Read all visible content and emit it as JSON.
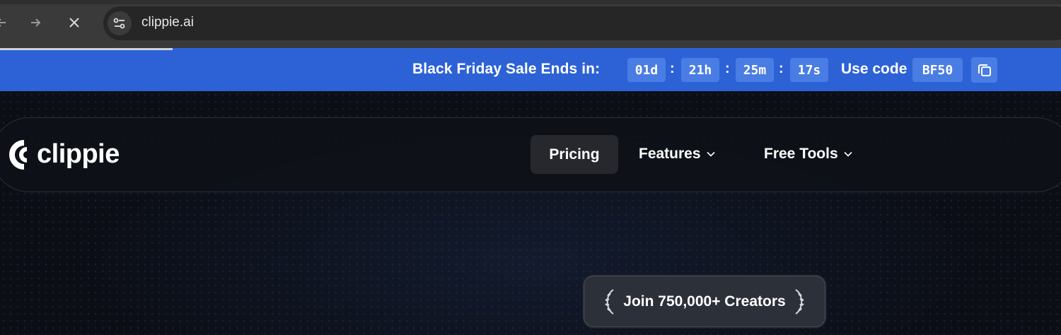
{
  "browser": {
    "url": "clippie.ai",
    "icons": {
      "back": "arrow-left-icon",
      "forward": "arrow-right-icon",
      "stop": "close-icon",
      "site_info": "tune-icon"
    }
  },
  "promo": {
    "title": "Black Friday Sale Ends in:",
    "countdown": {
      "days": "01d",
      "hours": "21h",
      "minutes": "25m",
      "seconds": "17s",
      "separator": ":"
    },
    "use_code_label": "Use code",
    "code": "BF50",
    "copy_icon": "copy-icon",
    "background_color": "#2d62d6"
  },
  "navbar": {
    "brand": "clippie",
    "items": [
      {
        "label": "Pricing"
      },
      {
        "label": "Features"
      },
      {
        "label": "Free Tools"
      }
    ]
  },
  "hero": {
    "badge": "Join 750,000+ Creators",
    "badge_icon": "laurel-icon"
  }
}
